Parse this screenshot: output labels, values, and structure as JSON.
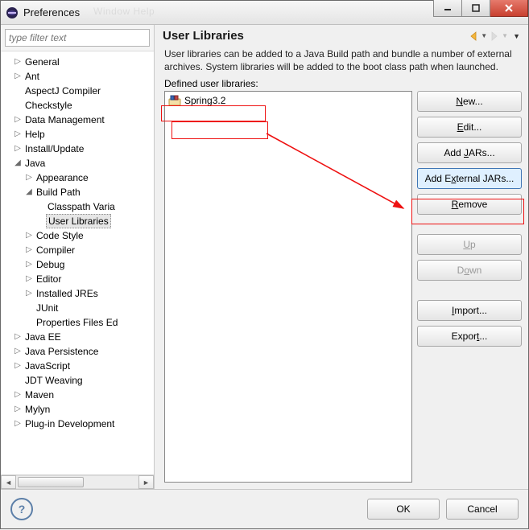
{
  "window": {
    "title": "Preferences"
  },
  "ghost_menu": "Window    Help",
  "filter": {
    "placeholder": "type filter text"
  },
  "tree": {
    "general": "General",
    "ant": "Ant",
    "aspectj": "AspectJ Compiler",
    "checkstyle": "Checkstyle",
    "datamgmt": "Data Management",
    "help": "Help",
    "install": "Install/Update",
    "java": "Java",
    "appearance": "Appearance",
    "buildpath": "Build Path",
    "classpathvars": "Classpath Varia",
    "userlibs": "User Libraries",
    "codestyle": "Code Style",
    "compiler": "Compiler",
    "debug": "Debug",
    "editor": "Editor",
    "installedjres": "Installed JREs",
    "junit": "JUnit",
    "propfiles": "Properties Files Ed",
    "javaee": "Java EE",
    "javapersist": "Java Persistence",
    "javascript": "JavaScript",
    "jdtweaving": "JDT Weaving",
    "maven": "Maven",
    "mylyn": "Mylyn",
    "plugindev": "Plug-in Development"
  },
  "panel": {
    "heading": "User Libraries",
    "description": "User libraries can be added to a Java Build path and bundle a number of external archives. System libraries will be added to the boot class path when launched.",
    "defined_label": "Defined user libraries:",
    "library_item": "Spring3.2"
  },
  "buttons": {
    "new": "New...",
    "edit": "Edit...",
    "addjars": "Add JARs...",
    "addextjars": "Add External JARs...",
    "remove": "Remove",
    "up": "Up",
    "down": "Down",
    "import": "Import...",
    "export": "Export...",
    "ok": "OK",
    "cancel": "Cancel"
  },
  "help_icon": "?"
}
